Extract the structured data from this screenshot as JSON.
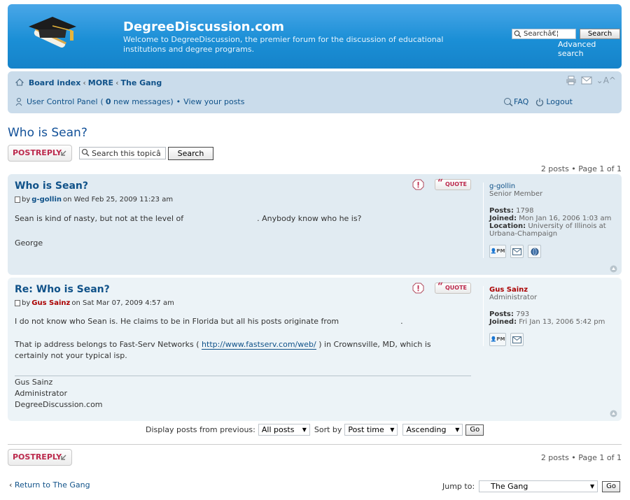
{
  "header": {
    "site_title": "DegreeDiscussion.com",
    "site_description": "Welcome to DegreeDiscussion, the premier forum for the discussion of educational institutions and degree programs.",
    "search_placeholder": "Searchâ€¦",
    "search_button": "Search",
    "advanced_search": "Advanced search"
  },
  "navbar": {
    "crumbs": [
      "Board index",
      "MORE",
      "The Gang"
    ],
    "ucp": "User Control Panel",
    "new_messages_count": "0",
    "new_messages_label": " new messages)",
    "view_posts": "View your posts",
    "faq": "FAQ",
    "logout": "Logout"
  },
  "topic": {
    "title": "Who is Sean?",
    "post_reply": "POSTREPLY",
    "search_placeholder": "Search this topicâ",
    "search_button": "Search",
    "pagination": "2 posts • Page 1 of 1"
  },
  "posts": [
    {
      "title": "Who is Sean?",
      "by": "by",
      "author": "g-gollin",
      "date": "on Wed Feb 25, 2009 11:23 am",
      "body_line1": "Sean is kind of nasty, but not at the level of",
      "body_line1_end": ". Anybody know who he is?",
      "body_line2": "George",
      "quote": "QUOTE",
      "profile": {
        "username": "g-gollin",
        "rank": "Senior Member",
        "posts_label": "Posts:",
        "posts": "1798",
        "joined_label": "Joined:",
        "joined": "Mon Jan 16, 2006 1:03 am",
        "location_label": "Location:",
        "location": "University of Illinois at Urbana-Champaign"
      }
    },
    {
      "title": "Re: Who is Sean?",
      "by": "by",
      "author": "Gus Sainz",
      "date": "on Sat Mar 07, 2009 4:57 am",
      "body_line1": "I do not know who Sean is. He claims to be in Florida but all his posts originate from",
      "body_line1_end": ".",
      "body_line2_start": "That ip address belongs to Fast-Serv Networks (",
      "link": "http://www.fastserv.com/web/",
      "body_line2_end": ") in Crownsville, MD, which is",
      "body_line3": "certainly not your typical isp.",
      "sig": [
        "Gus Sainz",
        "Administrator",
        "DegreeDiscussion.com"
      ],
      "quote": "QUOTE",
      "profile": {
        "username": "Gus Sainz",
        "rank": "Administrator",
        "posts_label": "Posts:",
        "posts": "793",
        "joined_label": "Joined:",
        "joined": "Fri Jan 13, 2006 5:42 pm"
      }
    }
  ],
  "display_options": {
    "label": "Display posts from previous:",
    "posts_value": "All posts",
    "sort_label": "Sort by",
    "sort_value": "Post time",
    "order_value": "Ascending",
    "go": "Go"
  },
  "footer": {
    "post_reply": "POSTREPLY",
    "pagination": "2 posts • Page 1 of 1",
    "return": "Return to The Gang",
    "jump_label": "Jump to:",
    "jump_value": "The Gang",
    "go": "Go"
  },
  "colors": {
    "header_blue": "#1b8fd6",
    "navbar_bg": "#cadceb",
    "post_bg_1": "#e1ebf2",
    "post_bg_2": "#ecf3f7",
    "link": "#105289",
    "button_red": "#bc2a4d",
    "admin_red": "#aa0000"
  }
}
